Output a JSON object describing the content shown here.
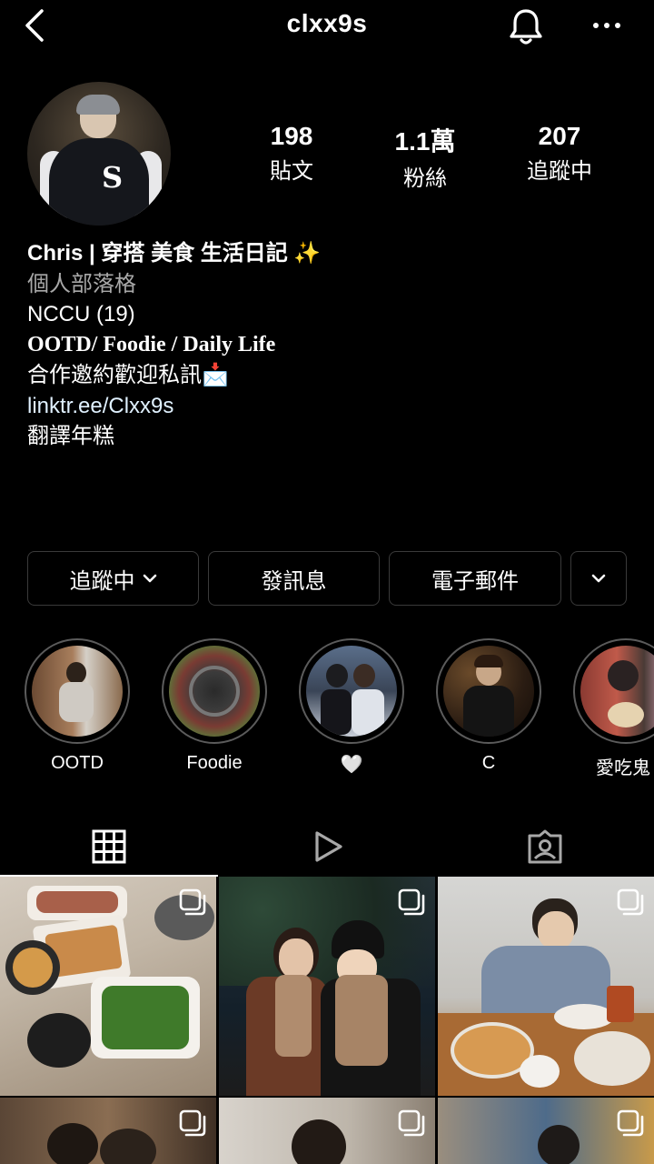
{
  "header": {
    "username": "clxx9s",
    "icons": [
      "back-icon",
      "bell-icon",
      "more-icon"
    ]
  },
  "stats": {
    "posts": {
      "value": "198",
      "label": "貼文"
    },
    "followers": {
      "value": "1.1萬",
      "label": "粉絲"
    },
    "following": {
      "value": "207",
      "label": "追蹤中"
    }
  },
  "bio": {
    "name": "Chris | 穿搭 美食 生活日記 ✨",
    "category": "個人部落格",
    "school": "NCCU (19)",
    "tagline": "OOTD/ Foodie / Daily Life",
    "collab": "合作邀約歡迎私訊📩",
    "link": "linktr.ee/Clxx9s",
    "translate": "翻譯年糕"
  },
  "actions": {
    "following": "追蹤中",
    "message": "發訊息",
    "email": "電子郵件"
  },
  "highlights": [
    {
      "label": "OOTD"
    },
    {
      "label": "Foodie"
    },
    {
      "label": "🤍"
    },
    {
      "label": "C"
    },
    {
      "label": "愛吃鬼"
    }
  ],
  "tabs": [
    "grid-icon",
    "reels-icon",
    "tagged-icon"
  ],
  "colors": {
    "background": "#000000",
    "text": "#ffffff",
    "muted": "#a8a8a8",
    "link": "#e0f1ff",
    "border": "#3a3a3a"
  }
}
